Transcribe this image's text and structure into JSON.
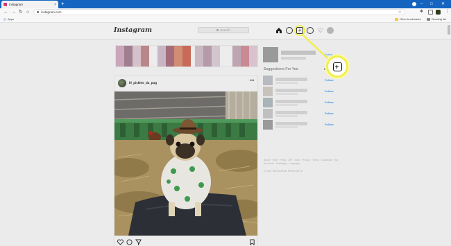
{
  "browser": {
    "tab_title": "Instagram",
    "tab_close": "×",
    "new_tab": "+",
    "address": "instagram.com",
    "bookmarks": {
      "apps": "Apps",
      "other": "Other bookmarks",
      "reading": "Reading list"
    },
    "window_controls": {
      "minimize": "–",
      "maximize": "□",
      "close": "✕"
    }
  },
  "instagram": {
    "logo": "Instagram",
    "search_placeholder": "Search",
    "nav_icons": [
      "home-icon",
      "messenger-icon",
      "new-post-icon",
      "explore-icon",
      "activity-heart-icon",
      "profile-avatar"
    ],
    "post": {
      "username": "lil_pickles_da_pug",
      "more": "•••"
    },
    "switch_label": "Switch",
    "suggestions_title": "Suggestions For You",
    "see_all": "See All",
    "follow_label": "Follow",
    "footer_links": "About · Help · Press · API · Jobs · Privacy · Terms · Locations · Top Accounts · Hashtags · Language",
    "copyright": "© 2021 INSTAGRAM FROM META"
  },
  "highlight": {
    "icon": "new-post-icon",
    "color": "#f1ef4a"
  }
}
